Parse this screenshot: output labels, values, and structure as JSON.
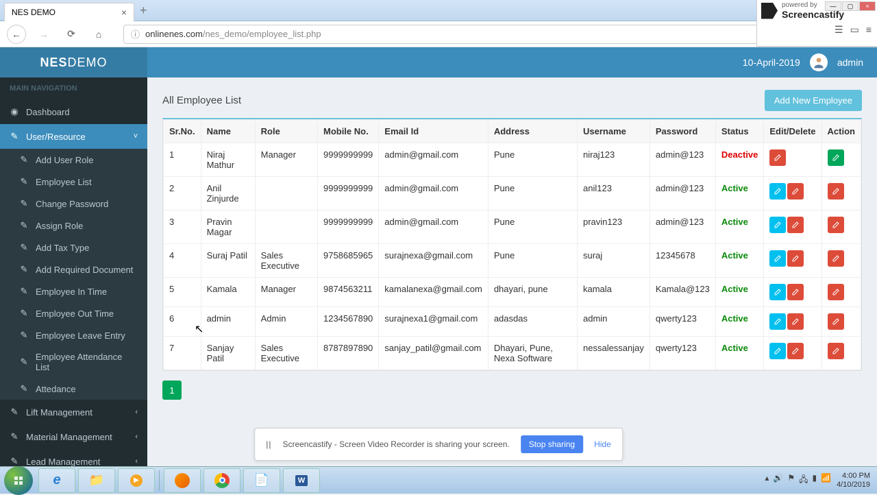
{
  "browser": {
    "tab_title": "NES DEMO",
    "url_domain": "onlinenes.com",
    "url_path": "/nes_demo/employee_list.php"
  },
  "screencastify": {
    "powered": "powered by",
    "brand": "Screencastify"
  },
  "header": {
    "logo_bold": "NES",
    "logo_light": "DEMO",
    "date": "10-April-2019",
    "user": "admin"
  },
  "sidebar": {
    "heading": "MAIN NAVIGATION",
    "dashboard": "Dashboard",
    "user_resource": "User/Resource",
    "subs": [
      "Add User Role",
      "Employee List",
      "Change Password",
      "Assign Role",
      "Add Tax Type",
      "Add Required Document",
      "Employee In Time",
      "Employee Out Time",
      "Employee Leave Entry",
      "Employee Attendance List",
      "Attedance"
    ],
    "lift": "Lift Management",
    "material": "Material Management",
    "lead": "Lead Management"
  },
  "panel": {
    "title": "All Employee List",
    "add_btn": "Add New Employee",
    "columns": [
      "Sr.No.",
      "Name",
      "Role",
      "Mobile No.",
      "Email Id",
      "Address",
      "Username",
      "Password",
      "Status",
      "Edit/Delete",
      "Action"
    ],
    "rows": [
      {
        "sr": "1",
        "name": "Niraj Mathur",
        "role": "Manager",
        "mobile": "9999999999",
        "email": "admin@gmail.com",
        "address": "Pune",
        "username": "niraj123",
        "password": "admin@123",
        "status": "Deactive",
        "status_class": "deactive",
        "ed": "red_only"
      },
      {
        "sr": "2",
        "name": "Anil Zinjurde",
        "role": "",
        "mobile": "9999999999",
        "email": "admin@gmail.com",
        "address": "Pune",
        "username": "anil123",
        "password": "admin@123",
        "status": "Active",
        "status_class": "active",
        "ed": "both"
      },
      {
        "sr": "3",
        "name": "Pravin Magar",
        "role": "",
        "mobile": "9999999999",
        "email": "admin@gmail.com",
        "address": "Pune",
        "username": "pravin123",
        "password": "admin@123",
        "status": "Active",
        "status_class": "active",
        "ed": "both"
      },
      {
        "sr": "4",
        "name": "Suraj Patil",
        "role": "Sales Executive",
        "mobile": "9758685965",
        "email": "surajnexa@gmail.com",
        "address": "Pune",
        "username": "suraj",
        "password": "12345678",
        "status": "Active",
        "status_class": "active",
        "ed": "both"
      },
      {
        "sr": "5",
        "name": "Kamala",
        "role": "Manager",
        "mobile": "9874563211",
        "email": "kamalanexa@gmail.com",
        "address": "dhayari, pune",
        "username": "kamala",
        "password": "Kamala@123",
        "status": "Active",
        "status_class": "active",
        "ed": "both"
      },
      {
        "sr": "6",
        "name": "admin",
        "role": "Admin",
        "mobile": "1234567890",
        "email": "surajnexa1@gmail.com",
        "address": "adasdas",
        "username": "admin",
        "password": "qwerty123",
        "status": "Active",
        "status_class": "active",
        "ed": "both"
      },
      {
        "sr": "7",
        "name": "Sanjay Patil",
        "role": "Sales Executive",
        "mobile": "8787897890",
        "email": "sanjay_patil@gmail.com",
        "address": "Dhayari, Pune, Nexa Software",
        "username": "nessalessanjay",
        "password": "qwerty123",
        "status": "Active",
        "status_class": "active",
        "ed": "both"
      }
    ],
    "page": "1"
  },
  "share": {
    "text": "Screencastify - Screen Video Recorder is sharing your screen.",
    "stop": "Stop sharing",
    "hide": "Hide"
  },
  "tray": {
    "time": "4:00 PM",
    "date": "4/10/2019"
  }
}
